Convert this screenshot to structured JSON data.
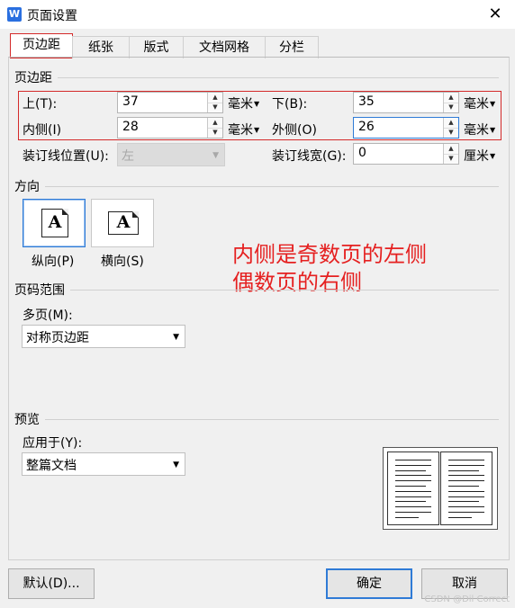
{
  "window": {
    "title": "页面设置",
    "app_icon": "W"
  },
  "tabs": [
    {
      "label": "页边距",
      "active": true
    },
    {
      "label": "纸张"
    },
    {
      "label": "版式"
    },
    {
      "label": "文档网格"
    },
    {
      "label": "分栏"
    }
  ],
  "margins": {
    "section_title": "页边距",
    "top": {
      "label": "上(T):",
      "value": "37",
      "unit": "毫米"
    },
    "bottom": {
      "label": "下(B):",
      "value": "35",
      "unit": "毫米"
    },
    "inner": {
      "label": "内侧(I)",
      "value": "28",
      "unit": "毫米"
    },
    "outer": {
      "label": "外侧(O)",
      "value": "26",
      "unit": "毫米"
    },
    "gutter_pos": {
      "label": "装订线位置(U):",
      "value": "左"
    },
    "gutter_width": {
      "label": "装订线宽(G):",
      "value": "0",
      "unit": "厘米"
    }
  },
  "orientation": {
    "section_title": "方向",
    "portrait_label": "纵向(P)",
    "landscape_label": "横向(S)",
    "glyph": "A",
    "selected": "portrait"
  },
  "annotation": {
    "line1": "内侧是奇数页的左侧",
    "line2": "偶数页的右侧",
    "color": "#e52020"
  },
  "page_range": {
    "section_title": "页码范围",
    "multi_label": "多页(M):",
    "multi_value": "对称页边距"
  },
  "preview": {
    "section_title": "预览",
    "apply_label": "应用于(Y):",
    "apply_value": "整篇文档"
  },
  "buttons": {
    "default": "默认(D)...",
    "ok": "确定",
    "cancel": "取消"
  },
  "watermark": "CSDN @Dil Correct",
  "colors": {
    "accent": "#2f7bd6",
    "highlight_box": "#d42a2a"
  }
}
